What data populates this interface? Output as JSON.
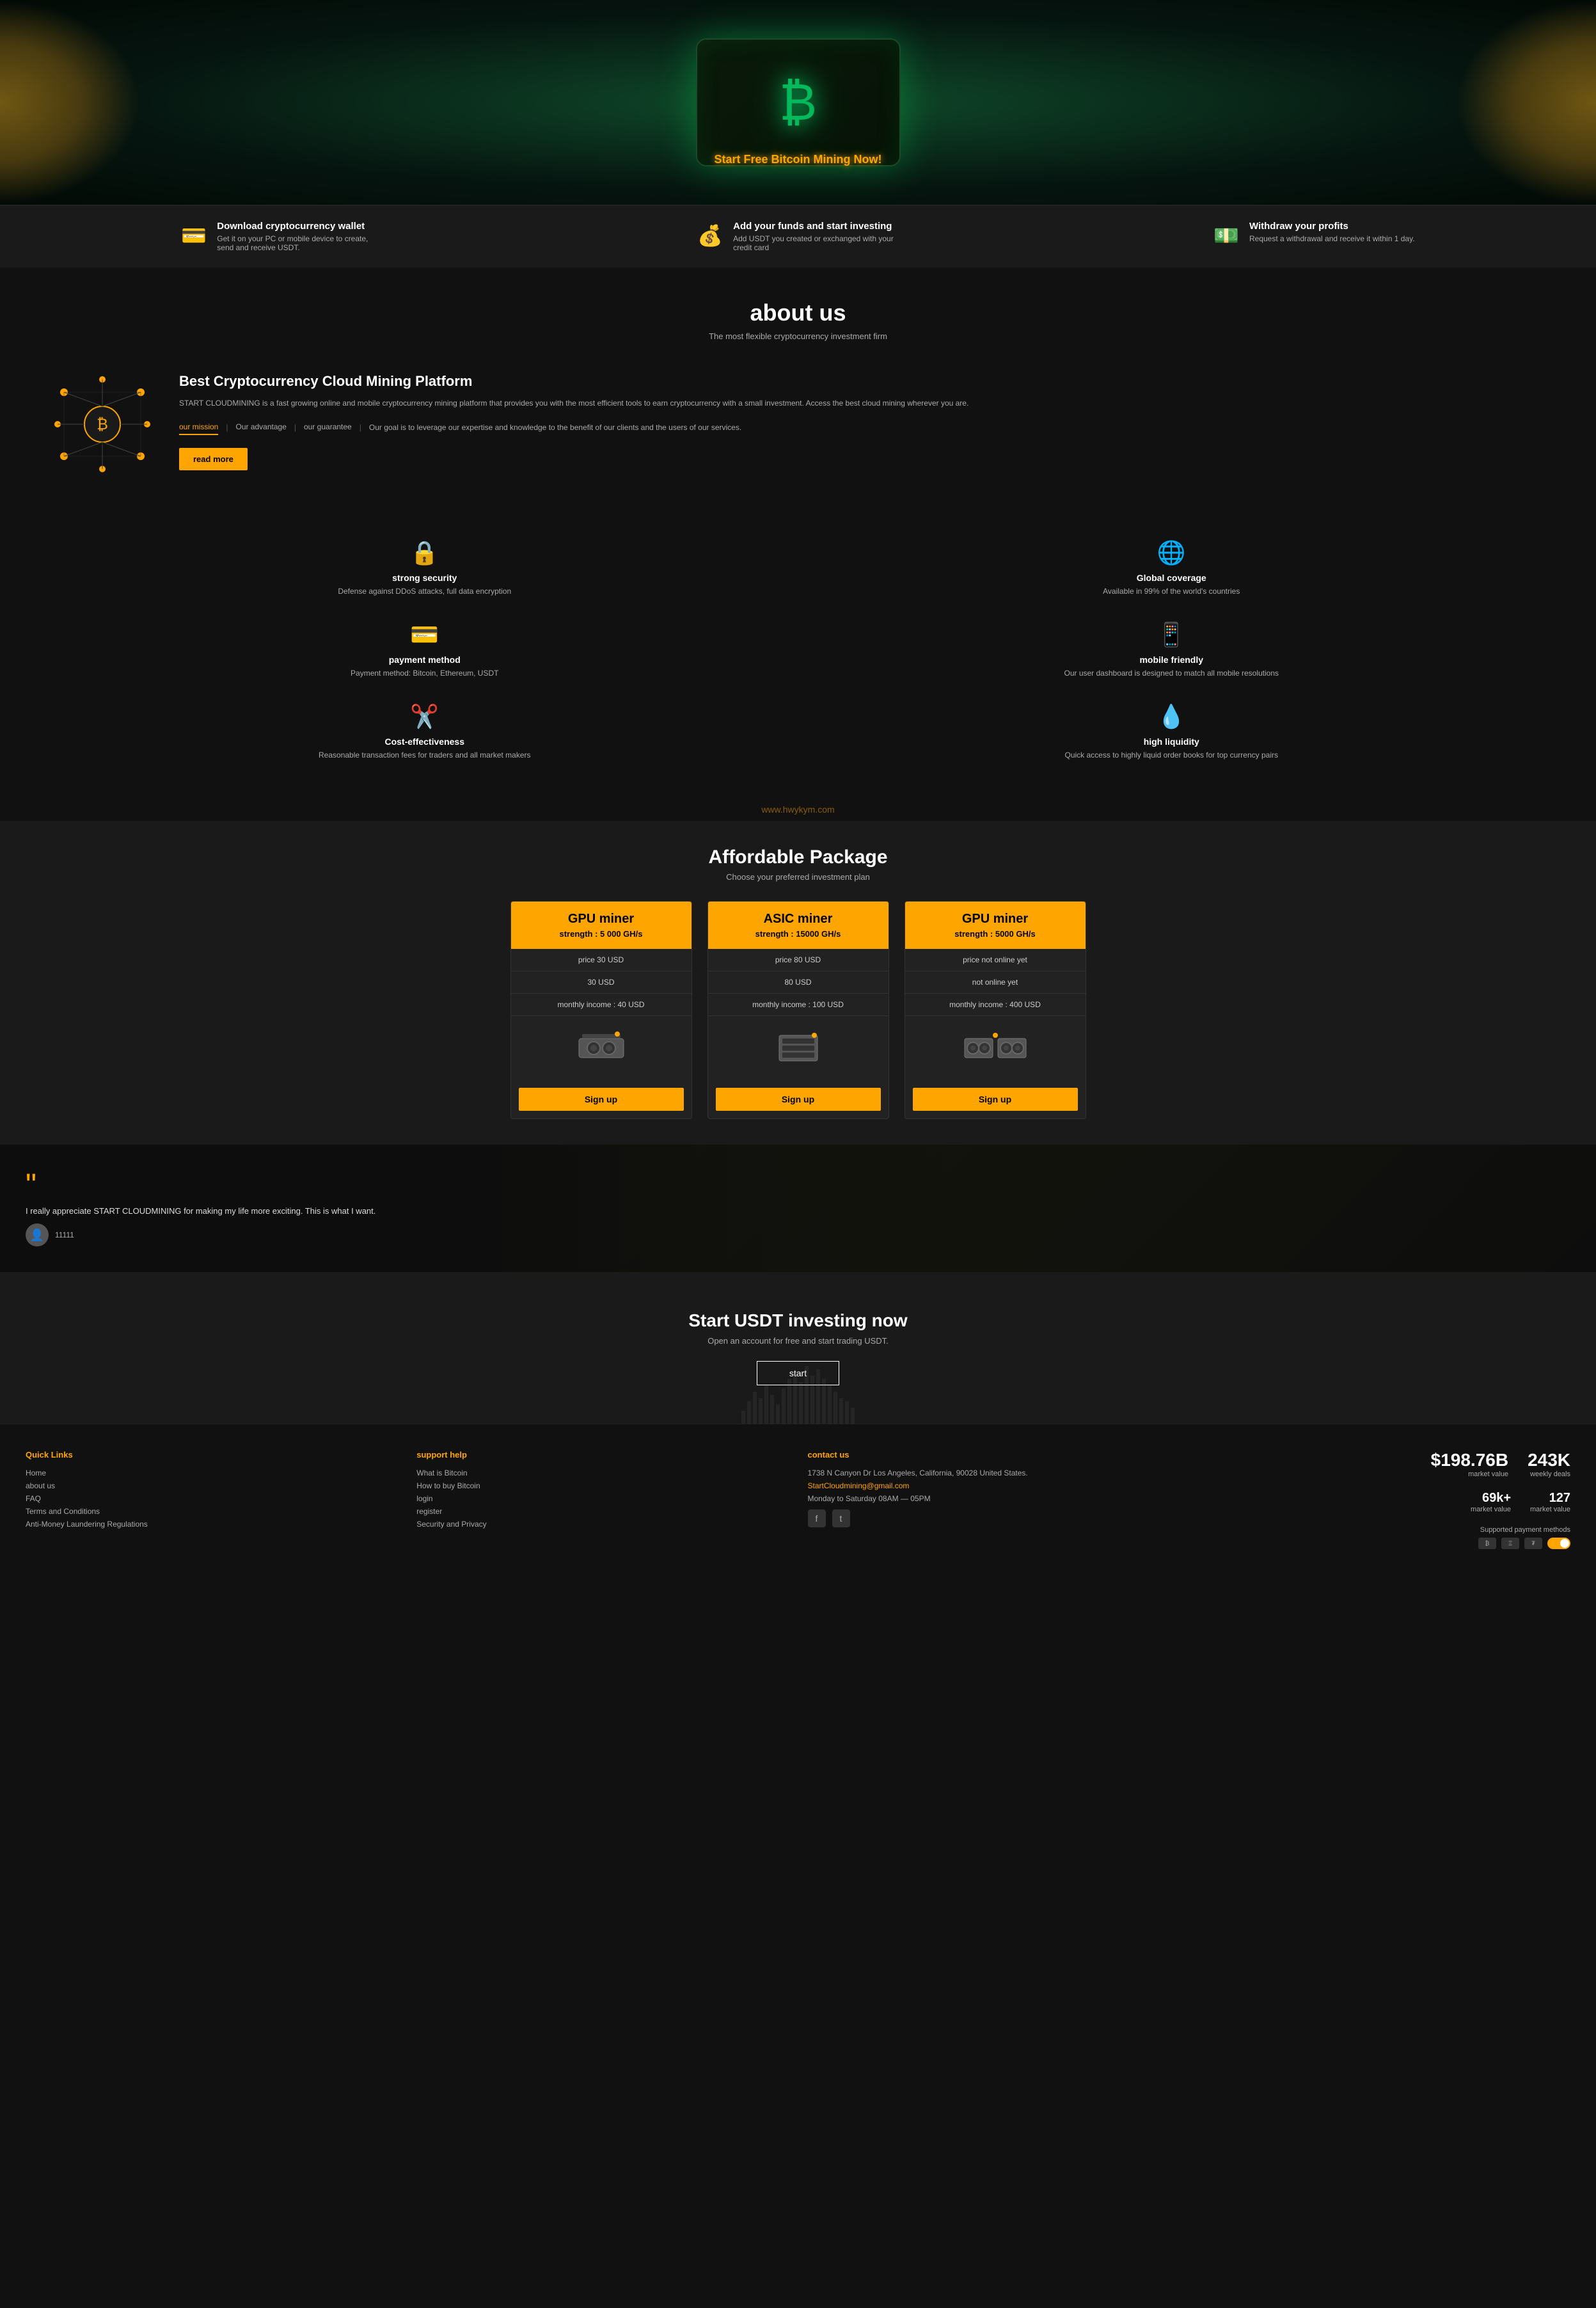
{
  "hero": {
    "cta": "Start Free Bitcoin Mining Now!"
  },
  "infobar": {
    "items": [
      {
        "icon": "💳",
        "title": "Download cryptocurrency wallet",
        "desc": "Get it on your PC or mobile device to create, send and receive USDT."
      },
      {
        "icon": "💰",
        "title": "Add your funds and start investing",
        "desc": "Add USDT you created or exchanged with your credit card"
      },
      {
        "icon": "💵",
        "title": "Withdraw your profits",
        "desc": "Request a withdrawal and receive it within 1 day."
      }
    ]
  },
  "about": {
    "section_title": "about us",
    "section_subtitle": "The most flexible cryptocurrency investment firm",
    "card_title": "Best Cryptocurrency Cloud Mining Platform",
    "card_body": "START CLOUDMINING is a fast growing online and mobile cryptocurrency mining platform that provides you with the most efficient tools to earn cryptocurrency with a small investment. Access the best cloud mining wherever you are.",
    "tabs": [
      "our mission",
      "Our advantage",
      "our guarantee"
    ],
    "goal": "Our goal is to leverage our expertise and knowledge to the benefit of our clients and the users of our services.",
    "read_more": "read more"
  },
  "features": [
    {
      "icon": "🔒",
      "title": "strong security",
      "desc": "Defense against DDoS attacks, full data encryption"
    },
    {
      "icon": "🌐",
      "title": "Global coverage",
      "desc": "Available in 99% of the world's countries"
    },
    {
      "icon": "💳",
      "title": "payment method",
      "desc": "Payment method: Bitcoin, Ethereum, USDT"
    },
    {
      "icon": "📱",
      "title": "mobile friendly",
      "desc": "Our user dashboard is designed to match all mobile resolutions"
    },
    {
      "icon": "✂️",
      "title": "Cost-effectiveness",
      "desc": "Reasonable transaction fees for traders and all market makers"
    },
    {
      "icon": "💧",
      "title": "high liquidity",
      "desc": "Quick access to highly liquid order books for top currency pairs"
    }
  ],
  "watermark": "www.hwykym.com",
  "packages": {
    "title": "Affordable Package",
    "subtitle": "Choose your preferred investment plan",
    "items": [
      {
        "name": "GPU miner",
        "strength": "strength : 5 000 GH/s",
        "price": "price 30 USD",
        "daily": "30 USD",
        "monthly": "monthly income : 40 USD",
        "signup": "Sign up"
      },
      {
        "name": "ASIC miner",
        "strength": "strength : 15000 GH/s",
        "price": "price 80 USD",
        "daily": "80 USD",
        "monthly": "monthly income : 100 USD",
        "signup": "Sign up"
      },
      {
        "name": "GPU miner",
        "strength": "strength : 5000 GH/s",
        "price": "price not online yet",
        "daily": "not online yet",
        "monthly": "monthly income : 400 USD",
        "signup": "Sign up"
      }
    ]
  },
  "testimonial": {
    "quote": "I really appreciate START CLOUDMINING for making my life more exciting. This is what I want.",
    "user": "11111",
    "avatar": "👤"
  },
  "cta": {
    "title": "Start USDT investing now",
    "subtitle": "Open an account for free and start trading USDT.",
    "button": "start"
  },
  "footer": {
    "quick_links": {
      "title": "Quick Links",
      "items": [
        "Home",
        "about us",
        "FAQ",
        "Terms and Conditions",
        "Anti-Money Laundering Regulations"
      ]
    },
    "support": {
      "title": "support help",
      "items": [
        "What is Bitcoin",
        "How to buy Bitcoin",
        "login",
        "register",
        "Security and Privacy"
      ]
    },
    "contact": {
      "title": "contact us",
      "address": "1738 N Canyon Dr Los Angeles, California, 90028 United States.",
      "email": "StartCloudmining@gmail.com",
      "hours": "Monday to Saturday 08AM — 05PM"
    },
    "stats": {
      "market_cap": "$198.76B",
      "weekly_deals": "243K",
      "market_cap_label": "market value",
      "weekly_deals_label": "weekly deals",
      "market_69": "69k+",
      "market_127": "127",
      "market_value_label": "market value",
      "market_value_label2": "market value",
      "payment_label": "Supported payment methods"
    }
  }
}
